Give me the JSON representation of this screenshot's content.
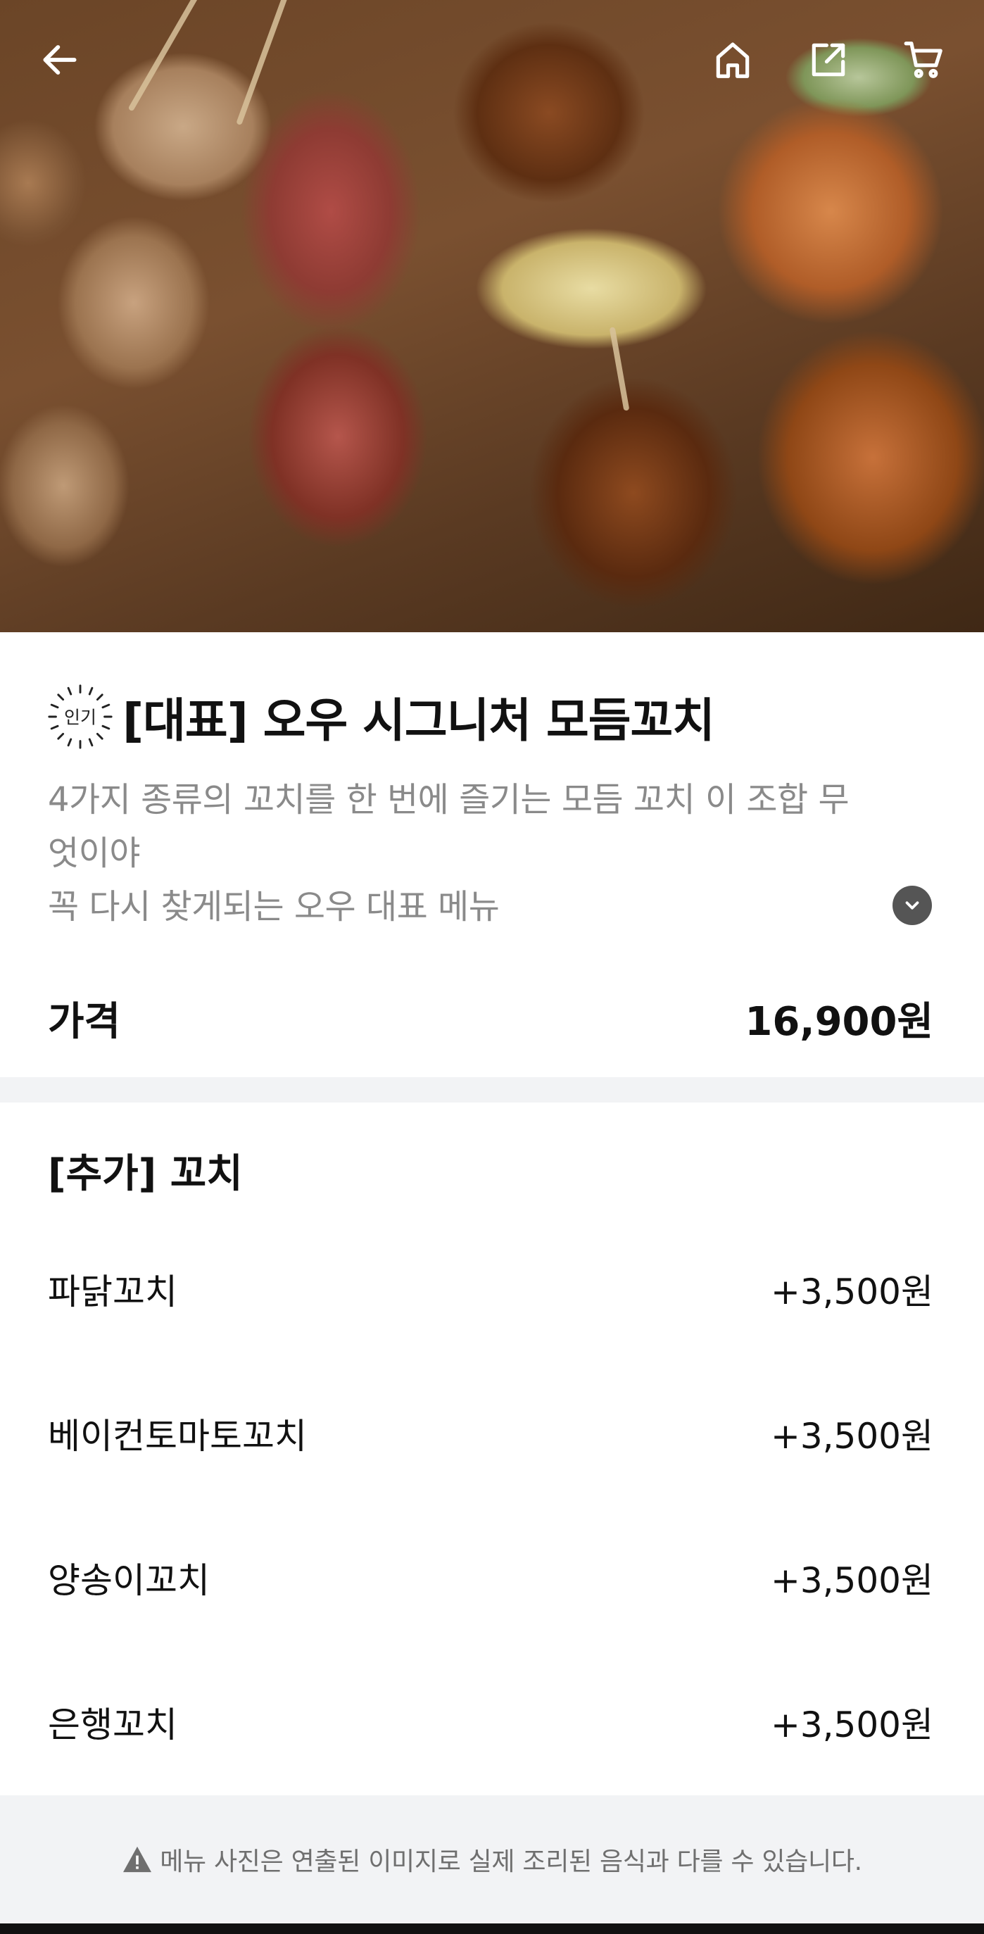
{
  "header": {
    "back_icon": "arrow-left-icon",
    "home_icon": "home-icon",
    "share_icon": "share-icon",
    "cart_icon": "cart-icon"
  },
  "hero": {
    "image": "food-photo"
  },
  "product": {
    "badge_text": "인기",
    "title": "[대표] 오우 시그니처 모듬꼬치",
    "description_lines": [
      "4가지 종류의 꼬치를 한 번에 즐기는 모듬 꼬치 이 조합 무",
      "엇이야",
      "꼭 다시 찾게되는 오우 대표 메뉴"
    ],
    "expand_icon": "chevron-down-icon",
    "price_label": "가격",
    "price_value": "16,900원"
  },
  "options": {
    "title": "[추가] 꼬치",
    "items": [
      {
        "name": "파닭꼬치",
        "price": "+3,500원"
      },
      {
        "name": "베이컨토마토꼬치",
        "price": "+3,500원"
      },
      {
        "name": "양송이꼬치",
        "price": "+3,500원"
      },
      {
        "name": "은행꼬치",
        "price": "+3,500원"
      }
    ]
  },
  "notice": {
    "icon": "warning-icon",
    "text": "메뉴 사진은 연출된 이미지로 실제 조리된 음식과 다를 수 있습니다."
  },
  "colors": {
    "text_primary": "#111111",
    "text_secondary": "#8a8a8a",
    "divider": "#f2f3f5",
    "icon_white": "#ffffff"
  }
}
